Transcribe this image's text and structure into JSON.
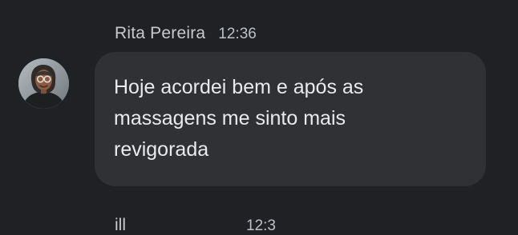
{
  "message": {
    "sender": "Rita Pereira",
    "time": "12:36",
    "text": "Hoje acordei bem e após as massagens me sinto mais revigorada"
  },
  "next_message": {
    "sender": "ill",
    "time": "12:3"
  },
  "colors": {
    "background": "#202124",
    "bubble": "#303134",
    "text": "#e8eaed",
    "meta": "#bdc1c6"
  }
}
